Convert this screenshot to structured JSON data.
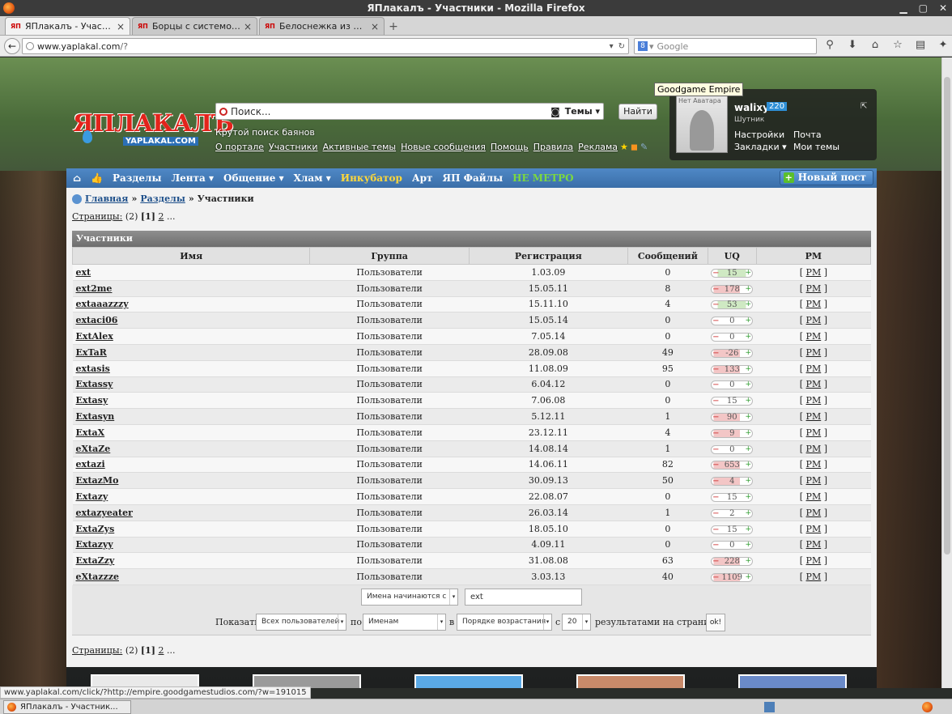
{
  "window": {
    "title": "ЯПлакалъ - Участники - Mozilla Firefox",
    "controls": [
      "▁",
      "▢",
      "✕"
    ]
  },
  "tabs": [
    {
      "title": "ЯПлакалъ - Участн...",
      "favicon": "ЯП",
      "active": true
    },
    {
      "title": "Борцы с системой ...",
      "favicon": "ЯП",
      "active": false
    },
    {
      "title": "Белоснежка из 9 р...",
      "favicon": "ЯП",
      "active": false
    }
  ],
  "newtab_label": "+",
  "addressbar": {
    "host": "www.yaplakal.com",
    "path": "/?"
  },
  "searchbar": {
    "placeholder": "Google",
    "engine_icon": "8"
  },
  "header": {
    "search_placeholder": "Поиск...",
    "topics_label": "Темы",
    "find_label": "Найти",
    "tagline": "Крутой поиск баянов",
    "logo_text": "ЯПЛАКАЛЪ",
    "logo_sub": "YAPLAKAL.COM",
    "links": [
      "О портале",
      "Участники",
      "Активные темы",
      "Новые сообщения",
      "Помощь",
      "Правила",
      "Реклама"
    ]
  },
  "user": {
    "no_avatar": "Нет Аватара",
    "name": "walixy",
    "score": "220",
    "rank": "Шутник",
    "links": [
      "Настройки",
      "Почта",
      "Закладки ▾",
      "Мои темы"
    ]
  },
  "tooltip": "Goodgame Empire",
  "menu": {
    "items": [
      "Разделы",
      "Лента ▾",
      "Общение ▾",
      "Хлам ▾"
    ],
    "item_incubator": "Инкубатор",
    "item_art": "Арт",
    "item_files": "ЯП Файлы",
    "item_nemetro": "НЕ МЕТРО",
    "new_post": "Новый пост"
  },
  "breadcrumb": {
    "home": "Главная",
    "sections": "Разделы",
    "current": "Участники",
    "sep": "»"
  },
  "pages": {
    "label": "Страницы:",
    "count": "(2)",
    "current": "[1]",
    "next": "2",
    "more": "..."
  },
  "table": {
    "caption": "Участники",
    "headers": [
      "Имя",
      "Группа",
      "Регистрация",
      "Сообщений",
      "UQ",
      "PM"
    ],
    "group": "Пользователи",
    "pm_label": "PM",
    "rows": [
      {
        "name": "ext",
        "reg": "1.03.09",
        "msgs": "0",
        "uq": "15",
        "uq_sign": "pos"
      },
      {
        "name": "ext2me",
        "reg": "15.05.11",
        "msgs": "8",
        "uq": "178",
        "uq_sign": "neg"
      },
      {
        "name": "extaaazzzy",
        "reg": "15.11.10",
        "msgs": "4",
        "uq": "53",
        "uq_sign": "pos"
      },
      {
        "name": "extaci06",
        "reg": "15.05.14",
        "msgs": "0",
        "uq": "0",
        "uq_sign": "zero"
      },
      {
        "name": "ExtAlex",
        "reg": "7.05.14",
        "msgs": "0",
        "uq": "0",
        "uq_sign": "zero"
      },
      {
        "name": "ExTaR",
        "reg": "28.09.08",
        "msgs": "49",
        "uq": "-26",
        "uq_sign": "neg"
      },
      {
        "name": "extasis",
        "reg": "11.08.09",
        "msgs": "95",
        "uq": "133",
        "uq_sign": "neg"
      },
      {
        "name": "Extassy",
        "reg": "6.04.12",
        "msgs": "0",
        "uq": "0",
        "uq_sign": "zero"
      },
      {
        "name": "Extasy",
        "reg": "7.06.08",
        "msgs": "0",
        "uq": "15",
        "uq_sign": "zero"
      },
      {
        "name": "Extasyn",
        "reg": "5.12.11",
        "msgs": "1",
        "uq": "90",
        "uq_sign": "neg"
      },
      {
        "name": "ExtaX",
        "reg": "23.12.11",
        "msgs": "4",
        "uq": "9",
        "uq_sign": "neg"
      },
      {
        "name": "eXtaZe",
        "reg": "14.08.14",
        "msgs": "1",
        "uq": "0",
        "uq_sign": "zero"
      },
      {
        "name": "extazi",
        "reg": "14.06.11",
        "msgs": "82",
        "uq": "653",
        "uq_sign": "neg"
      },
      {
        "name": "ExtazMo",
        "reg": "30.09.13",
        "msgs": "50",
        "uq": "4",
        "uq_sign": "neg"
      },
      {
        "name": "Extazy",
        "reg": "22.08.07",
        "msgs": "0",
        "uq": "15",
        "uq_sign": "zero"
      },
      {
        "name": "extazyeater",
        "reg": "26.03.14",
        "msgs": "1",
        "uq": "2",
        "uq_sign": "zero"
      },
      {
        "name": "ExtaZys",
        "reg": "18.05.10",
        "msgs": "0",
        "uq": "15",
        "uq_sign": "zero"
      },
      {
        "name": "Extazyy",
        "reg": "4.09.11",
        "msgs": "0",
        "uq": "0",
        "uq_sign": "zero"
      },
      {
        "name": "ExtaZzy",
        "reg": "31.08.08",
        "msgs": "63",
        "uq": "228",
        "uq_sign": "neg"
      },
      {
        "name": "eXtazzze",
        "reg": "3.03.13",
        "msgs": "40",
        "uq": "1109",
        "uq_sign": "neg"
      }
    ]
  },
  "filter": {
    "mode": "Имена начинаются с",
    "value": "ext",
    "show_label": "Показать",
    "who": "Всех пользователей",
    "by_label": "по",
    "sort_field": "Именам",
    "in_label": "в",
    "sort_order": "Порядке возрастания",
    "from_label": "с",
    "per_page": "20",
    "per_page_label": "результатами на страницу",
    "ok_label": "ok!"
  },
  "status_url": "www.yaplakal.com/click/?http://empire.goodgamestudios.com/?w=191015",
  "taskbar": {
    "item": "ЯПлакалъ - Участник..."
  }
}
